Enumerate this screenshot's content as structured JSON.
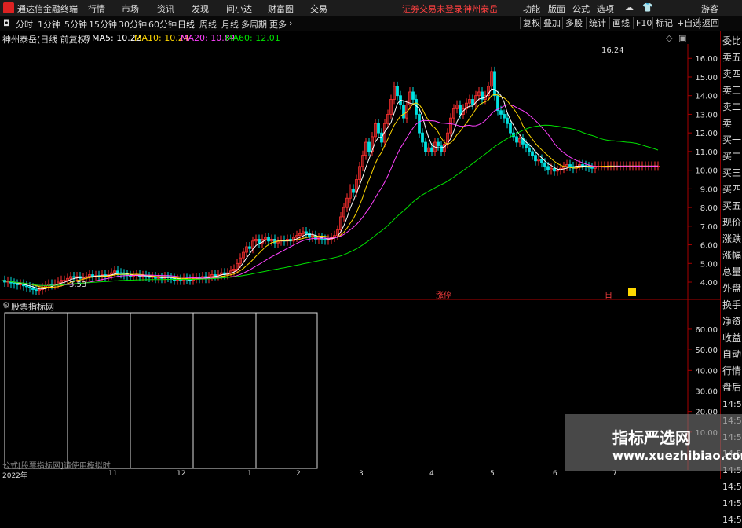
{
  "titlebar": {
    "app_name": "通达信金融终端",
    "menu": [
      "行情",
      "市场",
      "资讯",
      "发现",
      "问小达",
      "财富圈",
      "交易"
    ],
    "notice": "证券交易未登录",
    "stock": "神州泰岳",
    "right": [
      "功能",
      "版面",
      "公式",
      "选项",
      "游客"
    ]
  },
  "toolbar": {
    "periods": [
      "分时",
      "1分钟",
      "5分钟",
      "15分钟",
      "30分钟",
      "60分钟",
      "日线",
      "周线",
      "月线",
      "多周期",
      "更多"
    ],
    "selected": "日线",
    "right_buttons": [
      "复权",
      "叠加",
      "多股",
      "统计",
      "画线",
      "F10",
      "标记",
      "+自选",
      "返回"
    ]
  },
  "legend": {
    "name": "神州泰岳(日线 前复权)",
    "ma5": "MA5: 10.22",
    "ma10": "MA10: 10.24",
    "ma20": "MA20: 10.84",
    "ma60": "MA60: 12.01"
  },
  "chart_annotations": {
    "high": "16.24",
    "low": "3.53",
    "event1": "涨停",
    "event2": "日"
  },
  "sidepanel": [
    "委比",
    "卖五",
    "卖四",
    "卖三",
    "卖二",
    "卖一",
    "买一",
    "买二",
    "买三",
    "买四",
    "买五",
    "现价",
    "涨跌",
    "涨幅",
    "总量",
    "外盘",
    "换手",
    "净资",
    "收益",
    "自动",
    "行情",
    "盘后",
    "14:50",
    "14:50",
    "14:50",
    "14:50",
    "14:50",
    "14:50",
    "14:50",
    "14:50"
  ],
  "sub_panel": {
    "title": "股票指标网",
    "footer": "公式[股票指标网]请使用模拟时"
  },
  "watermark": {
    "line1": "指标严选网",
    "line2": "www.xuezhibiao.com"
  },
  "bottom_axis": [
    "2022年",
    "11",
    "12",
    "1",
    "2",
    "3",
    "4",
    "5",
    "6",
    "7"
  ],
  "chart_data": {
    "type": "line",
    "title": "神州泰岳(日线 前复权)",
    "ylim": [
      3.2,
      16.6
    ],
    "y_ticks": [
      4.0,
      5.0,
      6.0,
      7.0,
      8.0,
      9.0,
      10.0,
      11.0,
      12.0,
      13.0,
      14.0,
      15.0,
      16.0
    ],
    "sub_y_ticks": [
      10.0,
      20.0,
      30.0,
      40.0,
      50.0,
      60.0
    ],
    "x": [
      0,
      4,
      8,
      12,
      16,
      20,
      24,
      28,
      32,
      36,
      40,
      44,
      48,
      52,
      56,
      60,
      64,
      68,
      72,
      76,
      80,
      84,
      88,
      92,
      96,
      100,
      104,
      108,
      112,
      116,
      120,
      124,
      128,
      132,
      136,
      140,
      144,
      148,
      152,
      156,
      160,
      164,
      168,
      172,
      176,
      180,
      184,
      188,
      192,
      196,
      200,
      204,
      208,
      212,
      216,
      220,
      224,
      228,
      232,
      236,
      240,
      244,
      248,
      252,
      256,
      260,
      264,
      268,
      272,
      276,
      280,
      284,
      288,
      292,
      296,
      300,
      304,
      308,
      312,
      316,
      320,
      324,
      328,
      332,
      336,
      340,
      344,
      348,
      352,
      356,
      360,
      364,
      368,
      372,
      376,
      380,
      384,
      388,
      392,
      396,
      400,
      404,
      408,
      412,
      416,
      420,
      424,
      428,
      432,
      436,
      440,
      444,
      448,
      452,
      456,
      460,
      464,
      468,
      472,
      476,
      480,
      484,
      488,
      492,
      496,
      500,
      504,
      508,
      512,
      516,
      520,
      524,
      528,
      532,
      536,
      540,
      544,
      548,
      552,
      556,
      560,
      564,
      568,
      572,
      576,
      580,
      584,
      588,
      592,
      596,
      600,
      604,
      608,
      612,
      616,
      620,
      624,
      628,
      632,
      636,
      640,
      644,
      648,
      652,
      656,
      660,
      664,
      668,
      672,
      676,
      680,
      684,
      688,
      692,
      696,
      700,
      704,
      708,
      712,
      716,
      720,
      724,
      728,
      732,
      736,
      740,
      744,
      748,
      752,
      756,
      760,
      764,
      768,
      772,
      776,
      780,
      784,
      788,
      792,
      796,
      800,
      804,
      808,
      812,
      816,
      820,
      824,
      828,
      832,
      836,
      840,
      844,
      848,
      852,
      856,
      860,
      864,
      868,
      872
    ],
    "close": [
      4.1,
      4.0,
      4.05,
      3.95,
      3.9,
      3.85,
      3.9,
      3.8,
      3.75,
      3.7,
      3.6,
      3.55,
      3.6,
      3.7,
      3.8,
      3.9,
      3.85,
      3.9,
      4.0,
      4.1,
      4.1,
      4.2,
      4.3,
      4.25,
      4.3,
      4.2,
      4.25,
      4.3,
      4.4,
      4.3,
      4.35,
      4.3,
      4.4,
      4.3,
      4.4,
      4.5,
      4.6,
      4.5,
      4.45,
      4.4,
      4.35,
      4.3,
      4.35,
      4.4,
      4.3,
      4.35,
      4.3,
      4.25,
      4.3,
      4.2,
      4.25,
      4.2,
      4.3,
      4.25,
      4.2,
      4.1,
      4.15,
      4.1,
      4.2,
      4.15,
      4.1,
      4.2,
      4.25,
      4.2,
      4.3,
      4.2,
      4.3,
      4.4,
      4.35,
      4.4,
      4.5,
      4.4,
      4.5,
      4.6,
      4.7,
      5.0,
      5.3,
      5.6,
      5.9,
      5.8,
      6.2,
      6.3,
      6.1,
      6.3,
      6.4,
      6.2,
      6.3,
      6.1,
      6.2,
      6.25,
      6.2,
      6.3,
      6.2,
      6.4,
      6.5,
      6.6,
      6.7,
      6.6,
      6.4,
      6.5,
      6.3,
      6.4,
      6.3,
      6.25,
      6.3,
      6.4,
      6.5,
      6.8,
      7.5,
      8.0,
      8.5,
      9.0,
      8.8,
      9.5,
      10.2,
      10.8,
      11.5,
      11.0,
      11.8,
      12.5,
      12.0,
      11.5,
      12.5,
      13.0,
      13.8,
      14.5,
      14.0,
      13.5,
      12.8,
      13.5,
      14.2,
      13.8,
      13.0,
      12.0,
      11.5,
      11.0,
      11.2,
      11.0,
      11.5,
      11.3,
      11.0,
      11.4,
      12.0,
      12.8,
      13.3,
      13.5,
      13.0,
      13.3,
      13.6,
      13.8,
      13.5,
      14.0,
      14.2,
      13.8,
      14.0,
      14.5,
      15.3,
      14.0,
      13.2,
      13.0,
      12.8,
      12.5,
      12.0,
      11.8,
      11.5,
      11.7,
      11.4,
      11.2,
      11.0,
      10.8,
      10.5,
      10.6,
      10.4,
      10.2,
      10.0,
      10.1,
      9.95,
      10.0,
      10.1,
      10.2,
      10.3,
      10.2,
      10.1,
      10.22,
      10.3,
      10.25,
      10.2,
      10.15,
      10.1,
      10.22,
      10.22,
      10.22,
      10.22,
      10.22,
      10.22,
      10.22,
      10.22,
      10.22,
      10.22,
      10.22,
      10.22,
      10.22,
      10.22,
      10.22,
      10.22,
      10.22,
      10.22,
      10.22,
      10.22,
      10.22
    ],
    "series": [
      {
        "name": "MA5",
        "color": "#ffffff"
      },
      {
        "name": "MA10",
        "color": "#ffd700"
      },
      {
        "name": "MA20",
        "color": "#ff40ff"
      },
      {
        "name": "MA60",
        "color": "#00e000"
      }
    ]
  }
}
